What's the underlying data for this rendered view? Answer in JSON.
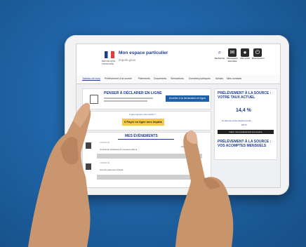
{
  "header": {
    "app_title": "Mon espace particulier",
    "app_sub": "impots.gouv",
    "rf": "RÉPUBLIQUE FRANÇAISE",
    "buttons": [
      {
        "label": "Recherche",
        "icon": "search-icon"
      },
      {
        "label": "Messagerie sécurisée",
        "icon": "mail-icon"
      },
      {
        "label": "Mon profil",
        "icon": "user-icon"
      },
      {
        "label": "Déconnexion",
        "icon": "power-icon"
      }
    ]
  },
  "nav": {
    "items": [
      "Tableau de bord",
      "Prélèvement à la source",
      "Paiements",
      "Documents",
      "Simulations",
      "Données publiques",
      "Achats",
      "Mes contacts"
    ]
  },
  "declaration": {
    "title": "PENSER À DÉCLARER EN LIGNE",
    "button": "Accéder à la déclaration en ligne"
  },
  "payment": {
    "question": "À quoi servent mes impôts ?",
    "button": "€  Payer en ligne mes impôts"
  },
  "events": {
    "title": "MES ÉVÉNEMENTS",
    "item_tag": "CONSULTÉ",
    "item1": "Contrat de prélèvement mensuel suite à ...",
    "item1_action": "Visualiser PDF",
    "item2": "Avis de paiement d'impôt"
  },
  "pas": {
    "title": "PRÉLÈVEMENT À LA SOURCE : VOTRE TAUX ACTUEL",
    "rate": "14,4 %",
    "note": "Le taux de votre conjoint est de :",
    "note_rate": "8,8 %",
    "button": "Gérer mon prélèvement à la source",
    "title2": "PRÉLÈVEMENT À LA SOURCE : VOS ACOMPTES MENSUELS"
  },
  "colors": {
    "background": "#1f64a6",
    "accent": "#1f3c8f",
    "yellow": "#f7c949"
  }
}
